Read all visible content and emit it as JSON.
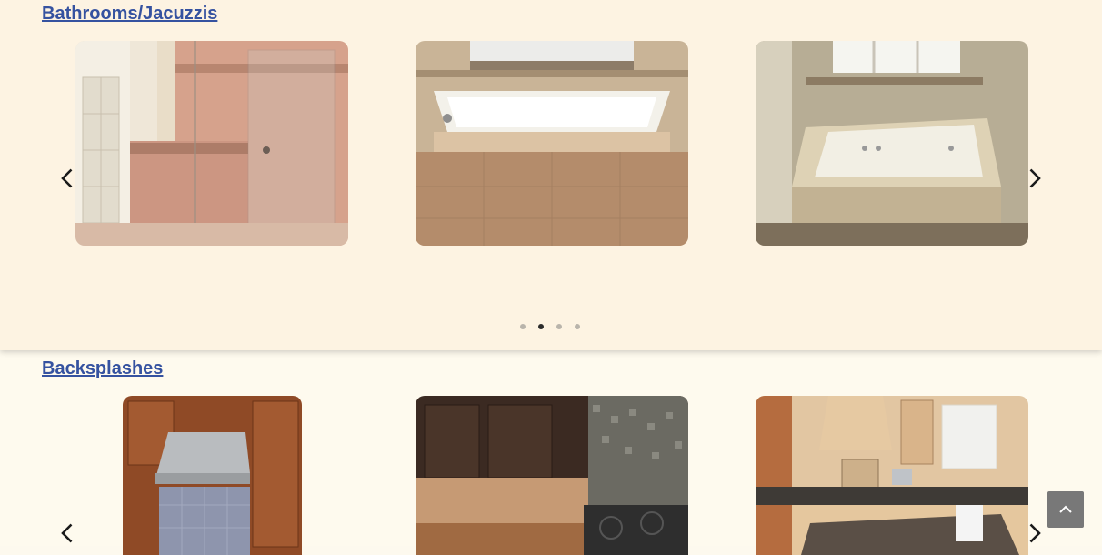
{
  "sections": [
    {
      "title": "Bathrooms/Jacuzzis",
      "slides": [
        {
          "icon": "photo-walk-in-shower"
        },
        {
          "icon": "photo-jacuzzi-tub-window"
        },
        {
          "icon": "photo-drop-in-jacuzzi"
        }
      ],
      "dots": 4,
      "active_dot": 2
    },
    {
      "title": "Backsplashes",
      "slides": [
        {
          "icon": "photo-backsplash-range-hood"
        },
        {
          "icon": "photo-mosaic-backsplash"
        },
        {
          "icon": "photo-kitchen-island"
        }
      ]
    }
  ],
  "controls": {
    "prev_icon": "chevron-left-icon",
    "next_icon": "chevron-right-icon",
    "scroll_top_icon": "chevron-up-icon"
  },
  "colors": {
    "section_bg": "#fdf3e2",
    "page_bg": "#fefaee",
    "link": "#3552a0",
    "scroll_button": "#787878"
  }
}
